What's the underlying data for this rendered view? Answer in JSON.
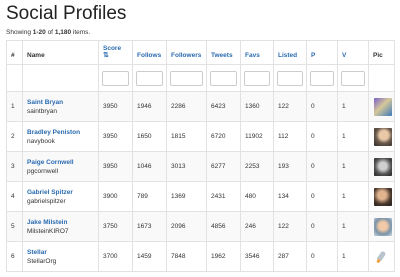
{
  "page": {
    "title": "Social Profiles",
    "summary_prefix": "Showing ",
    "summary_range": "1-20",
    "summary_mid": " of ",
    "summary_total": "1,180",
    "summary_suffix": " items."
  },
  "table": {
    "headers": {
      "num": "#",
      "name": "Name",
      "score": "Score",
      "score_sort_icon": "⇅",
      "follows": "Follows",
      "followers": "Followers",
      "tweets": "Tweets",
      "favs": "Favs",
      "listed": "Listed",
      "p": "P",
      "v": "V",
      "pic": "Pic"
    },
    "rows": [
      {
        "num": "1",
        "name": "Saint Bryan",
        "handle": "saintbryan",
        "score": "3950",
        "follows": "1946",
        "followers": "2286",
        "tweets": "6423",
        "favs": "1360",
        "listed": "122",
        "p": "0",
        "v": "1",
        "pic": "avatar-photo"
      },
      {
        "num": "2",
        "name": "Bradley Peniston",
        "handle": "navybook",
        "score": "3950",
        "follows": "1650",
        "followers": "1815",
        "tweets": "6720",
        "favs": "11902",
        "listed": "112",
        "p": "0",
        "v": "1",
        "pic": "avatar-photo"
      },
      {
        "num": "3",
        "name": "Paige Cornwell",
        "handle": "pgcornwell",
        "score": "3950",
        "follows": "1046",
        "followers": "3013",
        "tweets": "6277",
        "favs": "2253",
        "listed": "193",
        "p": "0",
        "v": "1",
        "pic": "avatar-photo"
      },
      {
        "num": "4",
        "name": "Gabriel Spitzer",
        "handle": "gabrielspitzer",
        "score": "3900",
        "follows": "789",
        "followers": "1369",
        "tweets": "2431",
        "favs": "480",
        "listed": "134",
        "p": "0",
        "v": "1",
        "pic": "avatar-photo"
      },
      {
        "num": "5",
        "name": "Jake Milstein",
        "handle": "MilsteinKIRO7",
        "score": "3750",
        "follows": "1673",
        "followers": "2096",
        "tweets": "4856",
        "favs": "246",
        "listed": "122",
        "p": "0",
        "v": "1",
        "pic": "avatar-photo"
      },
      {
        "num": "6",
        "name": "Stellar",
        "handle": "StellarOrg",
        "score": "3700",
        "follows": "1459",
        "followers": "7848",
        "tweets": "1962",
        "favs": "3546",
        "listed": "287",
        "p": "0",
        "v": "1",
        "pic": "rocket-icon"
      }
    ]
  },
  "colors": {
    "link": "#2a6bb0",
    "stripe": "#f9f9f9",
    "border": "#e2e2e2"
  }
}
